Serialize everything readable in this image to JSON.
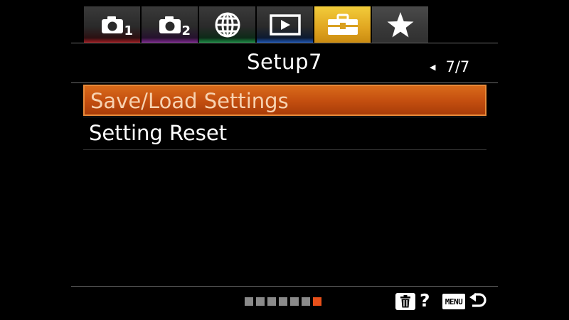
{
  "tabs": [
    {
      "id": "camera-1",
      "icon": "camera-icon",
      "num": "1",
      "accent": "#b01c22"
    },
    {
      "id": "camera-2",
      "icon": "camera-icon",
      "num": "2",
      "accent": "#8a2a9e"
    },
    {
      "id": "network",
      "icon": "globe-icon",
      "num": "",
      "accent": "#1c9a4a"
    },
    {
      "id": "playback",
      "icon": "playback-icon",
      "num": "",
      "accent": "#1d5cc8"
    },
    {
      "id": "setup",
      "icon": "toolbox-icon",
      "num": "",
      "accent": "#e0a520",
      "active": true
    },
    {
      "id": "my-menu",
      "icon": "star-icon",
      "num": "",
      "accent": "#555555"
    }
  ],
  "page": {
    "title": "Setup7",
    "indicator": "7/7",
    "current": 7,
    "total": 7
  },
  "menu_items": [
    {
      "label": "Save/Load Settings",
      "selected": true
    },
    {
      "label": "Setting Reset",
      "selected": false
    }
  ],
  "footer": {
    "help_label": "?",
    "menu_label": "MENU"
  },
  "colors": {
    "selection": "#c55010",
    "page_dot_active": "#e8501a"
  }
}
